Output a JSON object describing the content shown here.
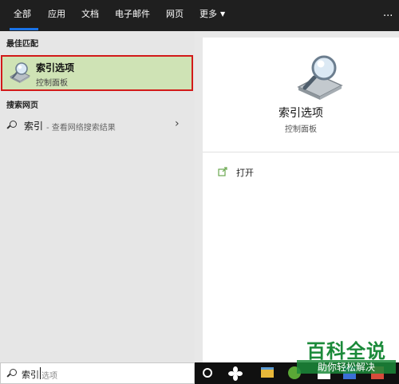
{
  "header": {
    "tabs": [
      {
        "label": "全部"
      },
      {
        "label": "应用"
      },
      {
        "label": "文档"
      },
      {
        "label": "电子邮件"
      },
      {
        "label": "网页"
      },
      {
        "label": "更多"
      }
    ],
    "active_tab": "全部",
    "overflow_label": "···"
  },
  "results": {
    "best_match_header": "最佳匹配",
    "best_match": {
      "title": "索引选项",
      "subtitle": "控制面板",
      "icon": "indexing-options-icon"
    },
    "web_header": "搜索网页",
    "web_suggestion": {
      "query": "索引",
      "hint": "- 查看网络搜索结果",
      "arrow": "›"
    }
  },
  "preview": {
    "title": "索引选项",
    "subtitle": "控制面板",
    "actions": [
      {
        "label": "打开",
        "icon": "open-icon"
      }
    ]
  },
  "taskbar": {
    "search_query": "索引",
    "search_placeholder": "选项"
  },
  "watermark": {
    "title": "百科全说",
    "subtitle": "助你轻松解决"
  },
  "colors": {
    "topbar": "#1f1f1f",
    "accent": "#1a73e8",
    "selected_bg": "#cfe3b5",
    "highlight_border": "#d21a1a",
    "watermark": "#1b8a3a"
  }
}
